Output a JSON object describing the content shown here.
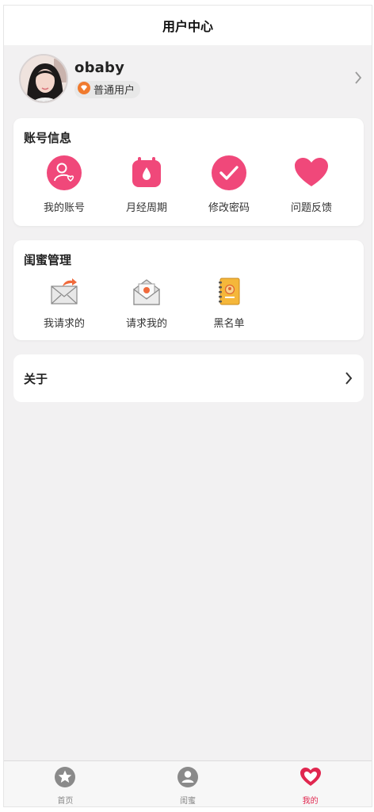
{
  "navbar": {
    "title": "用户中心"
  },
  "profile": {
    "username": "obaby",
    "badge": "普通用户"
  },
  "account": {
    "title": "账号信息",
    "items": [
      {
        "label": "我的账号",
        "icon": "user-heart-icon"
      },
      {
        "label": "月经周期",
        "icon": "calendar-drop-icon"
      },
      {
        "label": "修改密码",
        "icon": "check-circle-icon"
      },
      {
        "label": "问题反馈",
        "icon": "heart-icon"
      }
    ]
  },
  "bestie": {
    "title": "闺蜜管理",
    "items": [
      {
        "label": "我请求的",
        "icon": "envelope-send-icon"
      },
      {
        "label": "请求我的",
        "icon": "envelope-open-icon"
      },
      {
        "label": "黑名单",
        "icon": "address-book-icon"
      }
    ]
  },
  "about": {
    "label": "关于"
  },
  "tabbar": {
    "tabs": [
      {
        "label": "首页",
        "icon": "star-icon",
        "active": false
      },
      {
        "label": "闺蜜",
        "icon": "person-icon",
        "active": false
      },
      {
        "label": "我的",
        "icon": "heart-icon",
        "active": true
      }
    ]
  },
  "colors": {
    "pink": "#f0487a",
    "active": "#e0274f",
    "background": "#f2f1f2"
  }
}
